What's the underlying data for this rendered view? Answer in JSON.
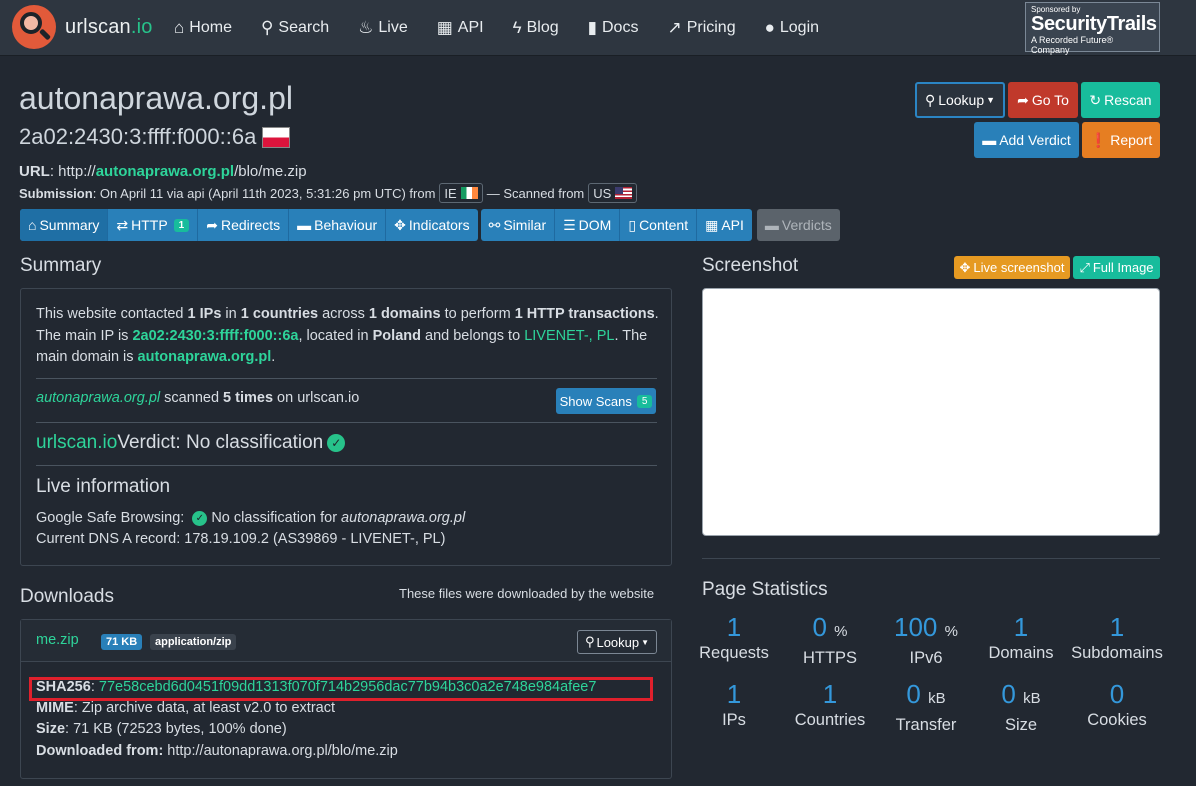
{
  "nav": {
    "brand_main": "urlscan",
    "brand_tld": ".io",
    "items": [
      {
        "label": "Home",
        "icon": "home-icon"
      },
      {
        "label": "Search",
        "icon": "search-icon"
      },
      {
        "label": "Live",
        "icon": "fire-icon"
      },
      {
        "label": "API",
        "icon": "qrcode-icon"
      },
      {
        "label": "Blog",
        "icon": "bolt-icon"
      },
      {
        "label": "Docs",
        "icon": "bookmark-icon"
      },
      {
        "label": "Pricing",
        "icon": "external-link-icon"
      },
      {
        "label": "Login",
        "icon": "user-icon"
      }
    ],
    "sponsor": {
      "line1": "Sponsored by",
      "line2": "SecurityTrails",
      "line3": "A Recorded Future® Company"
    }
  },
  "header": {
    "domain": "autonaprawa.org.pl",
    "ip": "2a02:2430:3:ffff:f000::6a",
    "url_label": "URL",
    "url_prefix": "http://",
    "url_domain": "autonaprawa.org.pl",
    "url_path": "/blo/me.zip",
    "submission_label": "Submission",
    "submission_text": ": On April 11 via api (April 11th 2023, 5:31:26 pm UTC) from",
    "from_cc": "IE",
    "scanned_from_text": "— Scanned from",
    "scanned_cc": "US"
  },
  "actions": {
    "lookup": "Lookup",
    "goto": "Go To",
    "rescan": "Rescan",
    "add_verdict": "Add Verdict",
    "report": "Report"
  },
  "tabs": {
    "summary": "Summary",
    "http": "HTTP",
    "http_count": "1",
    "redirects": "Redirects",
    "behaviour": "Behaviour",
    "indicators": "Indicators",
    "similar": "Similar",
    "dom": "DOM",
    "content": "Content",
    "api": "API",
    "verdicts": "Verdicts"
  },
  "summary": {
    "heading": "Summary",
    "t1": "This website contacted ",
    "ips": "1 IPs",
    "t2": " in ",
    "countries": "1 countries",
    "t3": " across ",
    "domains": "1 domains",
    "t4": " to perform ",
    "transactions": "1 HTTP transactions",
    "t5": ". The main IP is ",
    "main_ip": "2a02:2430:3:ffff:f000::6a",
    "t6": ", located in ",
    "country": "Poland",
    "t7": " and belongs to ",
    "asn": "LIVENET-, PL",
    "t8": ". The main domain is ",
    "main_domain": "autonaprawa.org.pl",
    "t9": ".",
    "scanned_domain": "autonaprawa.org.pl",
    "scanned_mid": " scanned ",
    "scanned_times": "5 times",
    "scanned_end": " on urlscan.io",
    "show_scans": "Show Scans",
    "show_scans_count": "5",
    "verdict_brand": "urlscan.io",
    "verdict_text": " Verdict: No classification",
    "live_heading": "Live information",
    "gsb_label": "Google Safe Browsing:",
    "gsb_text": "No classification for ",
    "gsb_domain": "autonaprawa.org.pl",
    "dns_text": "Current DNS A record: 178.19.109.2 (AS39869 - LIVENET-, PL)"
  },
  "downloads": {
    "heading": "Downloads",
    "note": "These files were downloaded by the website",
    "filename": "me.zip",
    "size_badge": "71 KB",
    "mime_badge": "application/zip",
    "lookup": "Lookup",
    "sha_label": "SHA256",
    "sha_value": "77e58cebd6d0451f09dd1313f070f714b2956dac77b94b3c0a2e748e984afee7",
    "mime_label": "MIME",
    "mime_value": ": Zip archive data, at least v2.0 to extract",
    "size_label": "Size",
    "size_value": ": 71 KB (72523 bytes, 100% done)",
    "from_label": "Downloaded from:",
    "from_value": " http://autonaprawa.org.pl/blo/me.zip"
  },
  "screenshot": {
    "heading": "Screenshot",
    "live_btn": "Live screenshot",
    "full_btn": "Full Image"
  },
  "stats": {
    "heading": "Page Statistics",
    "items": [
      {
        "value": "1",
        "unit": "",
        "label": "Requests"
      },
      {
        "value": "0",
        "unit": "%",
        "label": "HTTPS"
      },
      {
        "value": "100",
        "unit": "%",
        "label": "IPv6"
      },
      {
        "value": "1",
        "unit": "",
        "label": "Domains"
      },
      {
        "value": "1",
        "unit": "",
        "label": "Subdomains"
      },
      {
        "value": "1",
        "unit": "",
        "label": "IPs"
      },
      {
        "value": "1",
        "unit": "",
        "label": "Countries"
      },
      {
        "value": "0",
        "unit": "kB",
        "label": "Transfer"
      },
      {
        "value": "0",
        "unit": "kB",
        "label": "Size"
      },
      {
        "value": "0",
        "unit": "",
        "label": "Cookies"
      }
    ]
  }
}
